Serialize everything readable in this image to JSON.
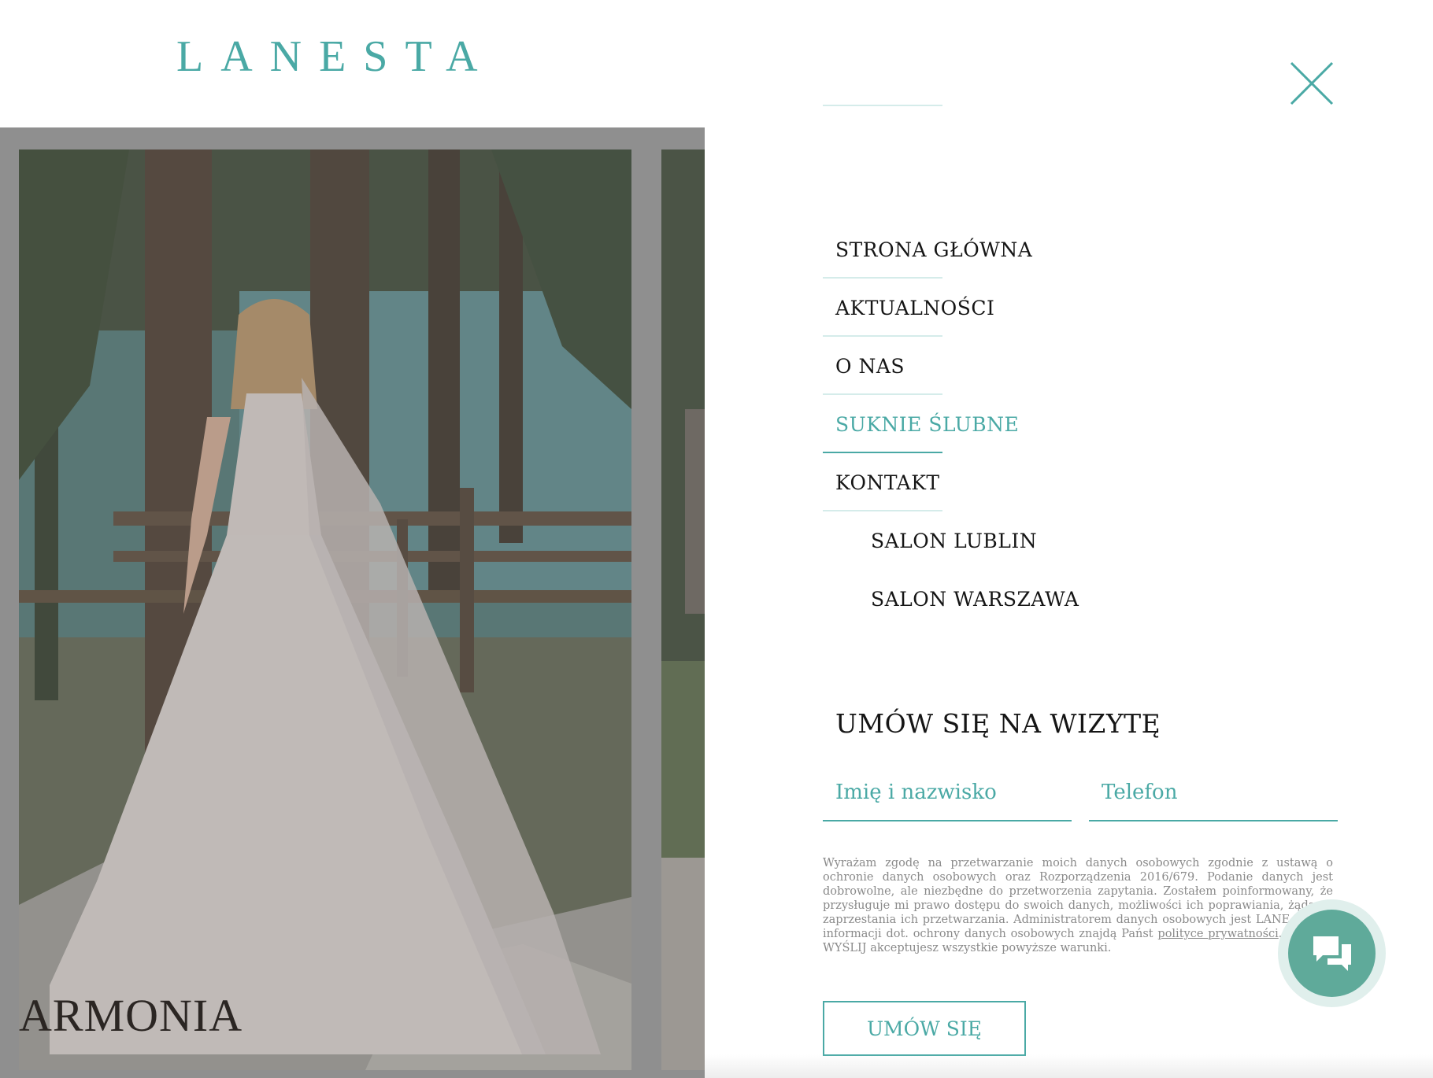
{
  "header": {
    "logo": "LANESTA"
  },
  "gallery": {
    "caption": "ARMONIA"
  },
  "menu": {
    "items": [
      {
        "label": "STRONA GŁÓWNA"
      },
      {
        "label": "AKTUALNOŚCI"
      },
      {
        "label": "O NAS"
      },
      {
        "label": "SUKNIE ŚLUBNE"
      },
      {
        "label": "KONTAKT"
      }
    ],
    "subitems": [
      {
        "label": "SALON LUBLIN"
      },
      {
        "label": "SALON WARSZAWA"
      }
    ],
    "active_item": "SUKNIE ŚLUBNE"
  },
  "form": {
    "title": "UMÓW SIĘ NA WIZYTĘ",
    "name_placeholder": "Imię i nazwisko",
    "phone_placeholder": "Telefon",
    "consent_text": "Wyrażam zgodę na przetwarzanie moich danych osobowych zgodnie z ustawą o ochronie danych osobowych oraz Rozporządzenia 2016/679. Podanie danych jest dobrowolne, ale niezbędne do przetworzenia zapytania. Zostałem poinformowany, że przysługuje mi prawo dostępu do swoich danych, możliwości ich poprawiania, żądania zaprzestania ich przetwarzania. Administratorem danych osobowych jest LANE",
    "consent_text_2": "Więcej informacji dot. ochrony danych osobowych znajdą Państ",
    "consent_link": "polityce prywatności",
    "consent_text_3": ". Klikając WYŚLIJ akceptujesz wszystkie powyższe warunki.",
    "submit_label": "UMÓW SIĘ"
  },
  "icons": {
    "close": "close-icon",
    "chat": "chat-icon"
  },
  "colors": {
    "accent": "#4aa9a5",
    "chat": "#5faa9a",
    "overlay": "#8f8f8f"
  }
}
